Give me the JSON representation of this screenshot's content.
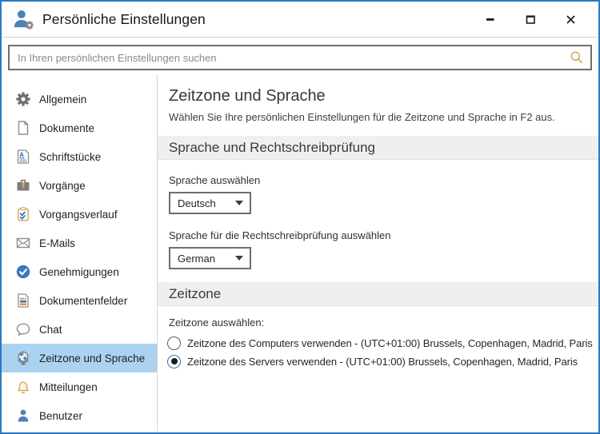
{
  "window": {
    "title": "Persönliche Einstellungen"
  },
  "search": {
    "placeholder": "In Ihren persönlichen Einstellungen suchen"
  },
  "sidebar": {
    "items": [
      {
        "label": "Allgemein",
        "icon": "gear-icon",
        "selected": false
      },
      {
        "label": "Dokumente",
        "icon": "document-icon",
        "selected": false
      },
      {
        "label": "Schriftstücke",
        "icon": "letter-document-icon",
        "selected": false
      },
      {
        "label": "Vorgänge",
        "icon": "briefcase-icon",
        "selected": false
      },
      {
        "label": "Vorgangsverlauf",
        "icon": "clipboard-checks-icon",
        "selected": false
      },
      {
        "label": "E-Mails",
        "icon": "envelope-icon",
        "selected": false
      },
      {
        "label": "Genehmigungen",
        "icon": "approval-check-icon",
        "selected": false
      },
      {
        "label": "Dokumentenfelder",
        "icon": "document-fields-icon",
        "selected": false
      },
      {
        "label": "Chat",
        "icon": "chat-bubble-icon",
        "selected": false
      },
      {
        "label": "Zeitzone und Sprache",
        "icon": "globe-icon",
        "selected": true
      },
      {
        "label": "Mitteilungen",
        "icon": "bell-icon",
        "selected": false
      },
      {
        "label": "Benutzer",
        "icon": "person-icon",
        "selected": false
      }
    ]
  },
  "main": {
    "title": "Zeitzone und Sprache",
    "subtitle": "Wählen Sie Ihre persönlichen Einstellungen für die Zeitzone und Sprache in F2 aus.",
    "language_section": {
      "heading": "Sprache und Rechtschreibprüfung",
      "language_label": "Sprache auswählen",
      "language_value": "Deutsch",
      "spellcheck_label": "Sprache für die Rechtschreibprüfung auswählen",
      "spellcheck_value": "German"
    },
    "timezone_section": {
      "heading": "Zeitzone",
      "group_label": "Zeitzone auswählen:",
      "options": [
        {
          "label": "Zeitzone des Computers verwenden - (UTC+01:00) Brussels, Copenhagen, Madrid, Paris",
          "selected": false
        },
        {
          "label": "Zeitzone des Servers verwenden - (UTC+01:00) Brussels, Copenhagen, Madrid, Paris",
          "selected": true
        }
      ]
    }
  },
  "colors": {
    "window_border": "#2b79c2",
    "selected_item_bg": "#abd3f1",
    "section_band_bg": "#efefef",
    "accent_blue": "#3c77bb",
    "icon_gray": "#8d8d8d",
    "gold": "#d2a85c"
  }
}
